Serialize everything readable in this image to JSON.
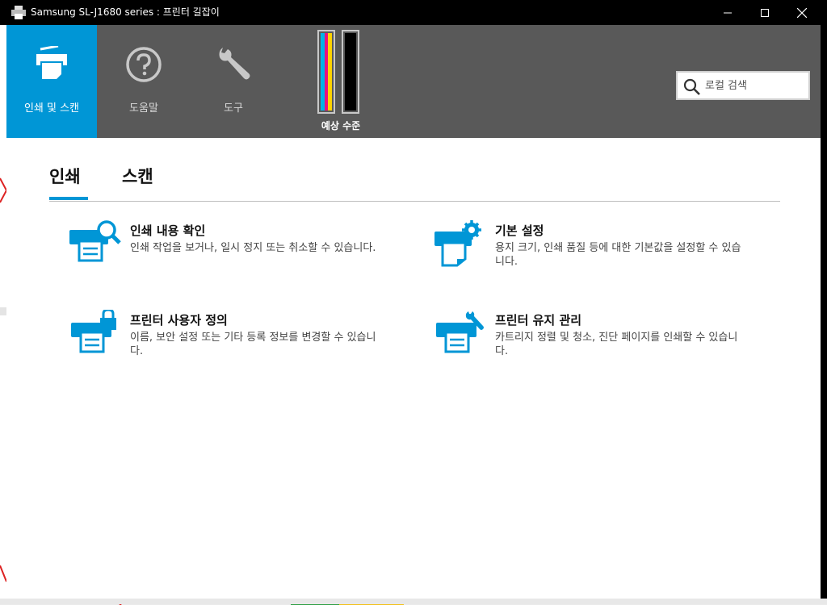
{
  "window": {
    "title": "Samsung SL-J1680 series : 프린터 길잡이",
    "icon": "printer-icon"
  },
  "toolbar": {
    "items": [
      {
        "label": "인쇄 및 스캔",
        "icon": "printer-scan-icon",
        "active": true
      },
      {
        "label": "도움말",
        "icon": "help-icon",
        "active": false
      },
      {
        "label": "도구",
        "icon": "wrench-icon",
        "active": false
      }
    ],
    "ink": {
      "label": "예상 수준",
      "cartridges": [
        {
          "name": "color",
          "colors": [
            "#00b4e6",
            "#e8127c",
            "#ffd400"
          ]
        },
        {
          "name": "black",
          "colors": [
            "#000000"
          ]
        }
      ]
    },
    "search": {
      "placeholder": "로컬 검색",
      "value": ""
    }
  },
  "tabs": [
    {
      "label": "인쇄",
      "selected": true
    },
    {
      "label": "스캔",
      "selected": false
    }
  ],
  "items": [
    {
      "title": "인쇄 내용 확인",
      "desc": "인쇄 작업을 보거나, 일시 정지 또는 취소할 수 있습니다.",
      "icon": "print-queue-icon"
    },
    {
      "title": "기본 설정",
      "desc": "용지 크기, 인쇄 품질 등에 대한 기본값을 설정할 수 있습니다.",
      "icon": "print-settings-icon"
    },
    {
      "title": "프린터 사용자 정의",
      "desc": "이름, 보안 설정 또는 기타 등록 정보를 변경할 수 있습니다.",
      "icon": "printer-lock-icon"
    },
    {
      "title": "프린터 유지 관리",
      "desc": "카트리지 정렬 및 청소, 진단 페이지를 인쇄할 수 있습니다.",
      "icon": "printer-maintenance-icon"
    }
  ],
  "colors": {
    "accent": "#0096d6",
    "toolbar": "#595959",
    "titlebar": "#000000"
  }
}
